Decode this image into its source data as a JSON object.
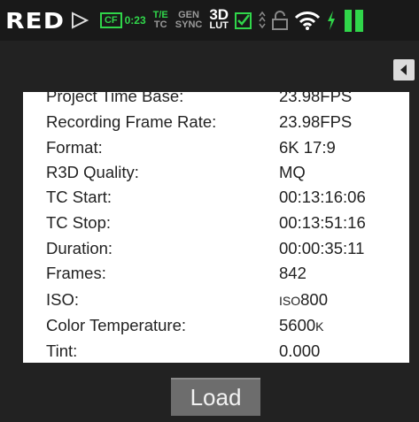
{
  "status_bar": {
    "logo": "RED",
    "media_badge": "CF",
    "media_time": "0:23",
    "timecode_top": "T/E",
    "timecode_bottom": "TC",
    "genlock_top": "GEN",
    "genlock_bottom": "SYNC",
    "lut_top": "3D",
    "lut_bottom": "LUT",
    "battery_level": 0.35,
    "colors": {
      "accent": "#30d64a",
      "grey": "#9a9a9a"
    },
    "icons": [
      "red-play-arrow-icon",
      "checkbox-icon",
      "arrow-indicator-icon",
      "lock-icon",
      "wifi-icon",
      "charging-icon",
      "battery-icon"
    ]
  },
  "clip_info": {
    "rows": [
      {
        "label": "Project Time Base:",
        "value": "23.98FPS"
      },
      {
        "label": "Recording Frame Rate:",
        "value": "23.98FPS"
      },
      {
        "label": "Format:",
        "value": "6K 17:9"
      },
      {
        "label": "R3D Quality:",
        "value": "MQ"
      },
      {
        "label": "TC Start:",
        "value": "00:13:16:06"
      },
      {
        "label": "TC Stop:",
        "value": "00:13:51:16"
      },
      {
        "label": "Duration:",
        "value": "00:00:35:11"
      },
      {
        "label": "Frames:",
        "value": "842"
      },
      {
        "label": "ISO:",
        "value_prefix": "ISO",
        "value": "800"
      },
      {
        "label": "Color Temperature:",
        "value": "5600",
        "value_suffix": "K"
      },
      {
        "label": "Tint:",
        "value": "0.000"
      }
    ]
  },
  "actions": {
    "load_label": "Load"
  }
}
